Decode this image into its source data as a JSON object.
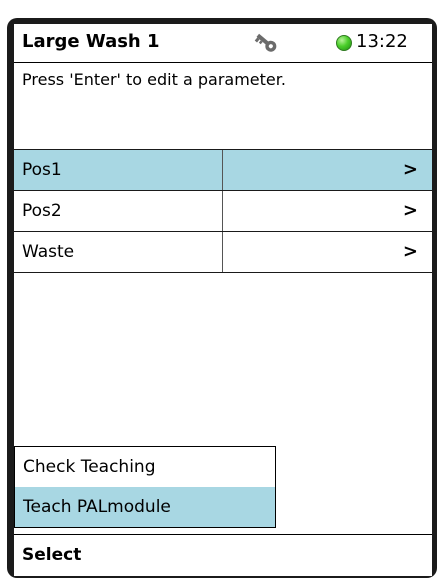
{
  "header": {
    "title": "Large Wash 1",
    "key_icon": "key-icon",
    "status_color": "#4ccf2b",
    "time": "13:22"
  },
  "hint": "Press 'Enter' to edit a parameter.",
  "list": {
    "selected_color": "#a8d7e3",
    "items": [
      {
        "label": "Pos1",
        "arrow": ">"
      },
      {
        "label": "Pos2",
        "arrow": ">"
      },
      {
        "label": "Waste",
        "arrow": ">"
      }
    ]
  },
  "popup": {
    "items": [
      {
        "label": "Check Teaching"
      },
      {
        "label": "Teach PALmodule"
      }
    ]
  },
  "footer": {
    "label": "Select"
  }
}
